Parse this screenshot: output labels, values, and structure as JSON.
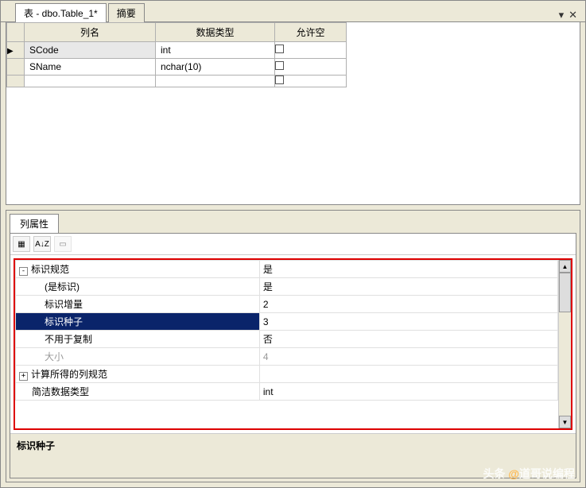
{
  "tabs": {
    "active": "表 - dbo.Table_1*",
    "other": "摘要"
  },
  "closeControls": {
    "dropdown": "▾",
    "close": "✕"
  },
  "grid": {
    "headers": {
      "name": "列名",
      "type": "数据类型",
      "null": "允许空"
    },
    "rows": [
      {
        "selected": true,
        "name": "SCode",
        "type": "int"
      },
      {
        "selected": false,
        "name": "SName",
        "type": "nchar(10)"
      },
      {
        "selected": false,
        "name": "",
        "type": ""
      }
    ]
  },
  "propTab": "列属性",
  "toolbarIcons": {
    "cat": "▦",
    "az": "A↓Z",
    "page": "▭"
  },
  "props": [
    {
      "exp": "-",
      "name": "标识规范",
      "val": "是",
      "indent": 0
    },
    {
      "name": "(是标识)",
      "val": "是",
      "indent": 1
    },
    {
      "name": "标识增量",
      "val": "2",
      "indent": 1
    },
    {
      "name": "标识种子",
      "val": "3",
      "indent": 1,
      "selected": true
    },
    {
      "name": "不用于复制",
      "val": "否",
      "indent": 1
    },
    {
      "name": "大小",
      "val": "4",
      "indent": 1,
      "gray": true
    },
    {
      "exp": "+",
      "name": "计算所得的列规范",
      "val": "",
      "indent": 0
    },
    {
      "name": "简洁数据类型",
      "val": "int",
      "indent": 0,
      "pad": true
    }
  ],
  "footerLabel": "标识种子",
  "watermark": {
    "prefix": "头条 ",
    "at": "@",
    "name": "道哥说编程"
  }
}
